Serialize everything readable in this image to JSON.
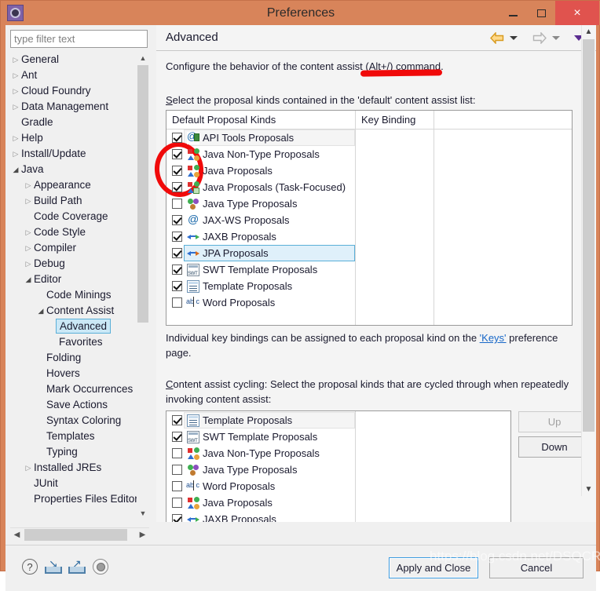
{
  "window": {
    "title": "Preferences",
    "app_icon": "gear-icon",
    "minimize_label": "Minimize",
    "maximize_label": "Maximize",
    "close_label": "×"
  },
  "sidebar": {
    "filter": {
      "value": "",
      "placeholder": "type filter text"
    },
    "items": [
      {
        "label": "General",
        "indent": 0,
        "state": "collapsed",
        "selected": false
      },
      {
        "label": "Ant",
        "indent": 0,
        "state": "collapsed",
        "selected": false
      },
      {
        "label": "Cloud Foundry",
        "indent": 0,
        "state": "collapsed",
        "selected": false
      },
      {
        "label": "Data Management",
        "indent": 0,
        "state": "collapsed",
        "selected": false
      },
      {
        "label": "Gradle",
        "indent": 0,
        "state": "leaf",
        "selected": false
      },
      {
        "label": "Help",
        "indent": 0,
        "state": "collapsed",
        "selected": false
      },
      {
        "label": "Install/Update",
        "indent": 0,
        "state": "collapsed",
        "selected": false
      },
      {
        "label": "Java",
        "indent": 0,
        "state": "expanded",
        "selected": false
      },
      {
        "label": "Appearance",
        "indent": 1,
        "state": "collapsed",
        "selected": false
      },
      {
        "label": "Build Path",
        "indent": 1,
        "state": "collapsed",
        "selected": false
      },
      {
        "label": "Code Coverage",
        "indent": 1,
        "state": "leaf",
        "selected": false
      },
      {
        "label": "Code Style",
        "indent": 1,
        "state": "collapsed",
        "selected": false
      },
      {
        "label": "Compiler",
        "indent": 1,
        "state": "collapsed",
        "selected": false
      },
      {
        "label": "Debug",
        "indent": 1,
        "state": "collapsed",
        "selected": false
      },
      {
        "label": "Editor",
        "indent": 1,
        "state": "expanded",
        "selected": false
      },
      {
        "label": "Code Minings",
        "indent": 2,
        "state": "leaf",
        "selected": false
      },
      {
        "label": "Content Assist",
        "indent": 2,
        "state": "expanded",
        "selected": false
      },
      {
        "label": "Advanced",
        "indent": 3,
        "state": "leaf",
        "selected": true
      },
      {
        "label": "Favorites",
        "indent": 3,
        "state": "leaf",
        "selected": false
      },
      {
        "label": "Folding",
        "indent": 2,
        "state": "leaf",
        "selected": false
      },
      {
        "label": "Hovers",
        "indent": 2,
        "state": "leaf",
        "selected": false
      },
      {
        "label": "Mark Occurrences",
        "indent": 2,
        "state": "leaf",
        "selected": false
      },
      {
        "label": "Save Actions",
        "indent": 2,
        "state": "leaf",
        "selected": false
      },
      {
        "label": "Syntax Coloring",
        "indent": 2,
        "state": "leaf",
        "selected": false
      },
      {
        "label": "Templates",
        "indent": 2,
        "state": "leaf",
        "selected": false
      },
      {
        "label": "Typing",
        "indent": 2,
        "state": "leaf",
        "selected": false
      },
      {
        "label": "Installed JREs",
        "indent": 1,
        "state": "collapsed",
        "selected": false
      },
      {
        "label": "JUnit",
        "indent": 1,
        "state": "leaf",
        "selected": false
      },
      {
        "label": "Properties Files Editor",
        "indent": 1,
        "state": "leaf",
        "selected": false
      }
    ]
  },
  "page": {
    "title": "Advanced",
    "nav": {
      "back": "back-arrow",
      "back_dropdown": "chevron-down-icon",
      "forward": "forward-arrow",
      "forward_dropdown": "chevron-down-icon",
      "menu": "chevron-down-icon"
    },
    "intro": "Configure the behavior of the content assist (Alt+/) command.",
    "section1_label": "Select the proposal kinds contained in the 'default' content assist list:",
    "table1": {
      "columns": [
        "Default Proposal Kinds",
        "Key Binding",
        ""
      ],
      "rows": [
        {
          "label": "API Tools Proposals",
          "checked": true,
          "icon": "api-tools-icon",
          "key_binding": "",
          "highlight": "soft"
        },
        {
          "label": "Java Non-Type Proposals",
          "checked": true,
          "icon": "java-nontype-icon",
          "key_binding": "",
          "highlight": "none"
        },
        {
          "label": "Java Proposals",
          "checked": true,
          "icon": "java-proposals-icon",
          "key_binding": "",
          "highlight": "none"
        },
        {
          "label": "Java Proposals (Task-Focused)",
          "checked": true,
          "icon": "java-task-icon",
          "key_binding": "",
          "highlight": "none"
        },
        {
          "label": "Java Type Proposals",
          "checked": false,
          "icon": "java-type-icon",
          "key_binding": "",
          "highlight": "none"
        },
        {
          "label": "JAX-WS Proposals",
          "checked": true,
          "icon": "jaxws-icon",
          "key_binding": "",
          "highlight": "none"
        },
        {
          "label": "JAXB Proposals",
          "checked": true,
          "icon": "jaxb-icon",
          "key_binding": "",
          "highlight": "none"
        },
        {
          "label": "JPA Proposals",
          "checked": true,
          "icon": "jpa-icon",
          "key_binding": "",
          "highlight": "blue"
        },
        {
          "label": "SWT Template Proposals",
          "checked": true,
          "icon": "swt-template-icon",
          "key_binding": "",
          "highlight": "none"
        },
        {
          "label": "Template Proposals",
          "checked": true,
          "icon": "template-icon",
          "key_binding": "",
          "highlight": "none"
        },
        {
          "label": "Word Proposals",
          "checked": false,
          "icon": "word-proposals-icon",
          "key_binding": "",
          "highlight": "none"
        }
      ]
    },
    "keys_note_prefix": "Individual key bindings can be assigned to each proposal kind on the ",
    "keys_link": "'Keys'",
    "keys_note_suffix": " preference",
    "keys_note_line2": "page.",
    "section2_line1": "Content assist cycling: Select the proposal kinds that are cycled through when repeatedly",
    "section2_line2": "invoking content assist:",
    "table2": {
      "rows": [
        {
          "label": "Template Proposals",
          "checked": true,
          "icon": "template-icon",
          "highlight": "soft"
        },
        {
          "label": "SWT Template Proposals",
          "checked": true,
          "icon": "swt-template-icon",
          "highlight": "none"
        },
        {
          "label": "Java Non-Type Proposals",
          "checked": false,
          "icon": "java-nontype-icon",
          "highlight": "none"
        },
        {
          "label": "Java Type Proposals",
          "checked": false,
          "icon": "java-type-icon",
          "highlight": "none"
        },
        {
          "label": "Word Proposals",
          "checked": false,
          "icon": "word-proposals-icon",
          "highlight": "none"
        },
        {
          "label": "Java Proposals",
          "checked": false,
          "icon": "java-proposals-icon",
          "highlight": "none"
        },
        {
          "label": "JAXB Proposals",
          "checked": true,
          "icon": "jaxb-icon",
          "highlight": "none"
        }
      ],
      "up_button": "Up",
      "up_enabled": false,
      "down_button": "Down",
      "down_enabled": true
    }
  },
  "footer": {
    "help_icon": "help-icon",
    "import_icon": "import-icon",
    "export_icon": "export-icon",
    "oomph_icon": "oomph-recorder-icon",
    "apply_button": "Apply and Close",
    "cancel_button": "Cancel"
  },
  "annotations": {
    "red_underline": "red-underline-annotation",
    "red_circle": "red-circle-annotation"
  },
  "watermark": "https://blog.csdn.net/DSQCR"
}
